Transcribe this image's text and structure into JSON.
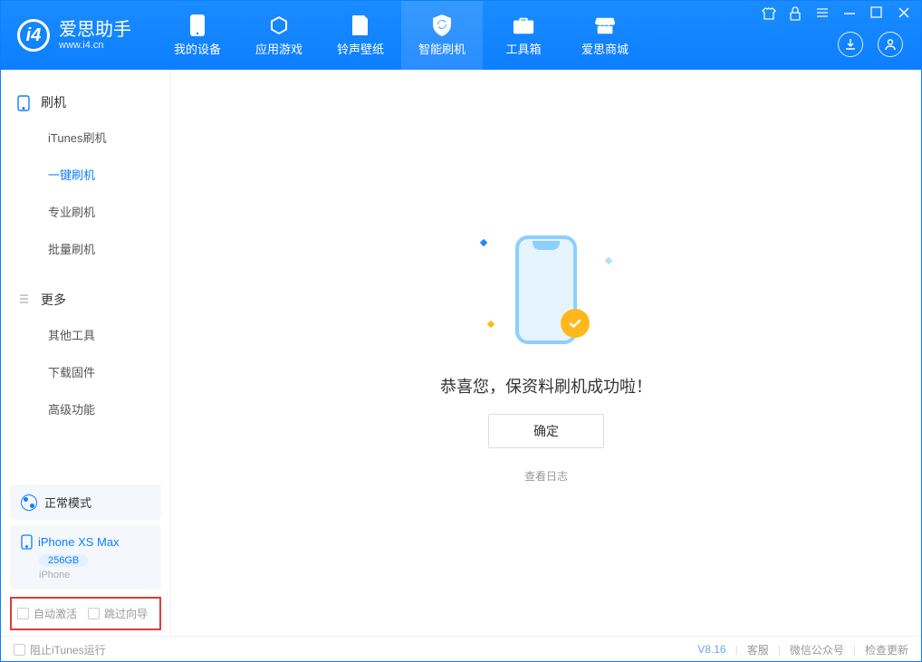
{
  "app": {
    "name": "爱思助手",
    "site": "www.i4.cn"
  },
  "nav": {
    "tabs": [
      {
        "label": "我的设备"
      },
      {
        "label": "应用游戏"
      },
      {
        "label": "铃声壁纸"
      },
      {
        "label": "智能刷机"
      },
      {
        "label": "工具箱"
      },
      {
        "label": "爱思商城"
      }
    ],
    "active_index": 3
  },
  "sidebar": {
    "sections": [
      {
        "title": "刷机",
        "items": [
          "iTunes刷机",
          "一键刷机",
          "专业刷机",
          "批量刷机"
        ],
        "active_index": 1
      },
      {
        "title": "更多",
        "items": [
          "其他工具",
          "下载固件",
          "高级功能"
        ],
        "active_index": -1
      }
    ],
    "mode_label": "正常模式",
    "device": {
      "name": "iPhone XS Max",
      "capacity": "256GB",
      "type": "iPhone"
    },
    "checkboxes": {
      "auto_activate": "自动激活",
      "skip_guide": "跳过向导"
    }
  },
  "result": {
    "title": "恭喜您，保资料刷机成功啦！",
    "confirm": "确定",
    "view_logs": "查看日志"
  },
  "footer": {
    "block_itunes": "阻止iTunes运行",
    "version": "V8.16",
    "links": [
      "客服",
      "微信公众号",
      "检查更新"
    ]
  }
}
